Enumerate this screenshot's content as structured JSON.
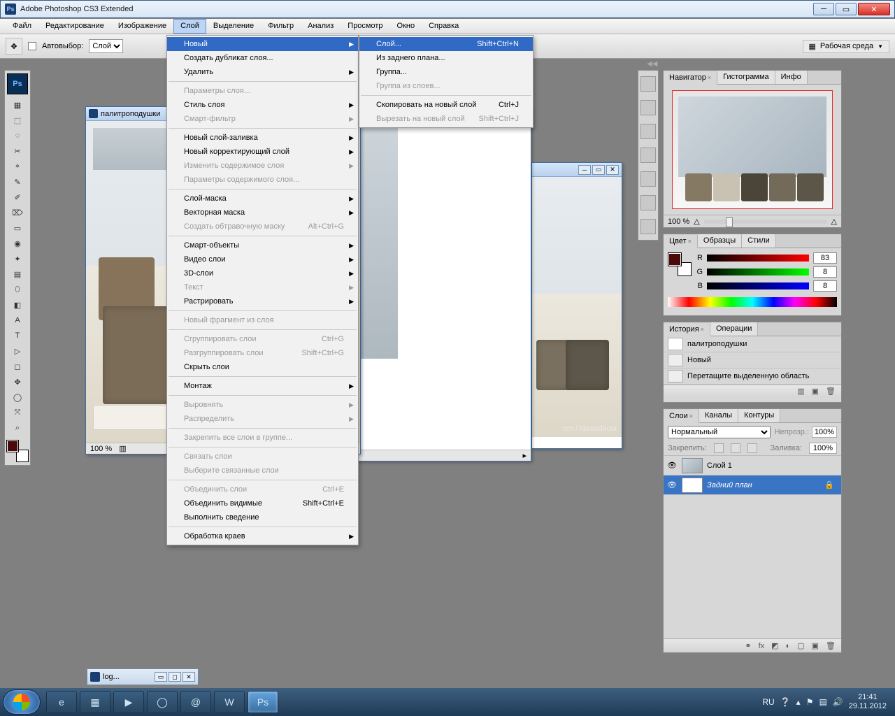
{
  "window": {
    "title": "Adobe Photoshop CS3 Extended"
  },
  "menubar": [
    "Файл",
    "Редактирование",
    "Изображение",
    "Слой",
    "Выделение",
    "Фильтр",
    "Анализ",
    "Просмотр",
    "Окно",
    "Справка"
  ],
  "options": {
    "auto_select_label": "Автовыбор:",
    "auto_select_value": "Слой",
    "workspace_label": "Рабочая среда"
  },
  "layer_menu": {
    "new": "Новый",
    "dup": "Создать дубликат слоя...",
    "delete": "Удалить",
    "props": "Параметры слоя...",
    "style": "Стиль слоя",
    "smartfilter": "Смарт-фильтр",
    "fill_layer": "Новый слой-заливка",
    "adj_layer": "Новый корректирующий слой",
    "change_content": "Изменить содержимое слоя",
    "content_opts": "Параметры содержимого слоя...",
    "mask": "Слой-маска",
    "vmask": "Векторная маска",
    "clip": "Создать обтравочную маску",
    "clip_sc": "Alt+Ctrl+G",
    "smart": "Смарт-объекты",
    "video": "Видео слои",
    "d3": "3D-слои",
    "text": "Текст",
    "raster": "Растрировать",
    "slice": "Новый фрагмент из слоя",
    "group": "Сгруппировать слои",
    "group_sc": "Ctrl+G",
    "ungroup": "Разгруппировать слои",
    "ungroup_sc": "Shift+Ctrl+G",
    "hide": "Скрыть слои",
    "arrange": "Монтаж",
    "align": "Выровнять",
    "distribute": "Распределить",
    "lockall": "Закрепить все слои в группе...",
    "link": "Связать слои",
    "sellinked": "Выберите связанные слои",
    "merge": "Объединить слои",
    "merge_sc": "Ctrl+E",
    "mergevis": "Объединить видимые",
    "mergevis_sc": "Shift+Ctrl+E",
    "flatten": "Выполнить сведение",
    "matting": "Обработка краев"
  },
  "new_submenu": {
    "layer": "Слой...",
    "layer_sc": "Shift+Ctrl+N",
    "from_bg": "Из заднего плана...",
    "group": "Группа...",
    "group_from": "Группа из слоев...",
    "copy": "Скопировать на новый слой",
    "copy_sc": "Ctrl+J",
    "cut": "Вырезать на новый слой",
    "cut_sc": "Shift+Ctrl+J"
  },
  "docs": {
    "front_title": "палитроподушки",
    "front_zoom": "100 %",
    "back_watermark": "om / ideasdecor",
    "mini_title": "log..."
  },
  "panels": {
    "navigator": {
      "tab1": "Навигатор",
      "tab2": "Гистограмма",
      "tab3": "Инфо",
      "zoom": "100 %"
    },
    "color": {
      "tab1": "Цвет",
      "tab2": "Образцы",
      "tab3": "Стили",
      "r_label": "R",
      "r_val": "83",
      "g_label": "G",
      "g_val": "8",
      "b_label": "B",
      "b_val": "8"
    },
    "history": {
      "tab1": "История",
      "tab2": "Операции",
      "snapshot": "палитроподушки",
      "s1": "Новый",
      "s2": "Перетащите выделенную область"
    },
    "layers": {
      "tab1": "Слои",
      "tab2": "Каналы",
      "tab3": "Контуры",
      "blend": "Нормальный",
      "opacity_lbl": "Непрозр.:",
      "opacity_val": "100%",
      "lock_lbl": "Закрепить:",
      "fill_lbl": "Заливка:",
      "fill_val": "100%",
      "layer1": "Слой 1",
      "layer_bg": "Задний план"
    }
  },
  "tools": [
    "▦",
    "⬚",
    "◌",
    "✂",
    "⌖",
    "✎",
    "✐",
    "⌦",
    "▭",
    "◉",
    "✦",
    "▤",
    "⬯",
    "◧",
    "A",
    "T",
    "▷",
    "◻",
    "✥",
    "◯",
    "⤧",
    "⌕"
  ],
  "tray": {
    "lang": "RU",
    "time": "21:41",
    "date": "29.11.2012"
  },
  "colors": {
    "fg": "#4b0909",
    "bg": "#ffffff",
    "highlight": "#316ac5"
  }
}
